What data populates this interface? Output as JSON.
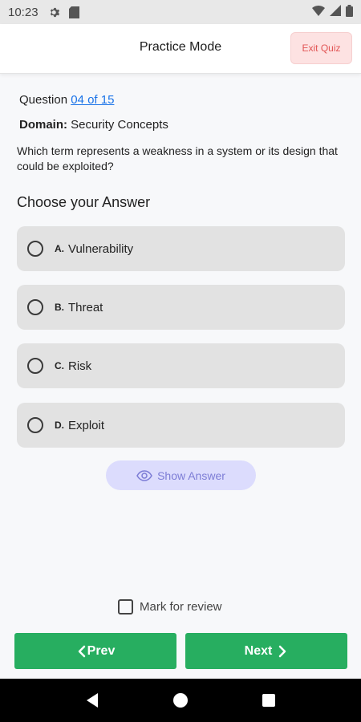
{
  "status_bar": {
    "time": "10:23"
  },
  "app_bar": {
    "title": "Practice Mode",
    "exit_label": "Exit Quiz"
  },
  "question": {
    "prefix": "Question",
    "progress": "04 of 15",
    "domain_label": "Domain:",
    "domain_value": "Security Concepts",
    "text": "Which term represents a weakness in a system or its design that could be exploited?"
  },
  "choose_heading": "Choose your Answer",
  "options": [
    {
      "letter": "A.",
      "text": "Vulnerability"
    },
    {
      "letter": "B.",
      "text": "Threat"
    },
    {
      "letter": "C.",
      "text": "Risk"
    },
    {
      "letter": "D.",
      "text": "Exploit"
    }
  ],
  "show_answer_label": "Show Answer",
  "mark_review_label": "Mark for review",
  "nav": {
    "prev_label": "Prev",
    "next_label": "Next"
  },
  "colors": {
    "primary_green": "#27ae60",
    "exit_red": "#e25555",
    "show_answer_bg": "#dcdcfd",
    "link_blue": "#1a73e8"
  }
}
